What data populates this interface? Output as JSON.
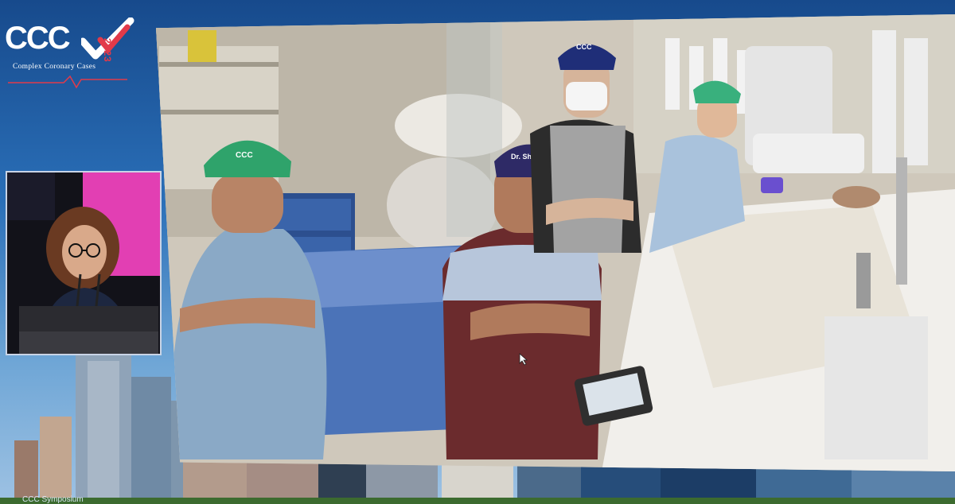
{
  "brand": {
    "logo_letters": "CCC",
    "logo_year": "2023",
    "logo_subtitle": "Complex Coronary Cases",
    "colors": {
      "accent_red": "#e23a4a",
      "background_blue": "#1f5aa3"
    }
  },
  "feed": {
    "cap_labels": {
      "left_cap": "CCC",
      "right_cap": "CCC"
    },
    "name_badge": "Dr. Sharma"
  },
  "footer": {
    "text": "CCC Symposium"
  },
  "cursor": {
    "icon": "mouse-pointer-icon"
  }
}
